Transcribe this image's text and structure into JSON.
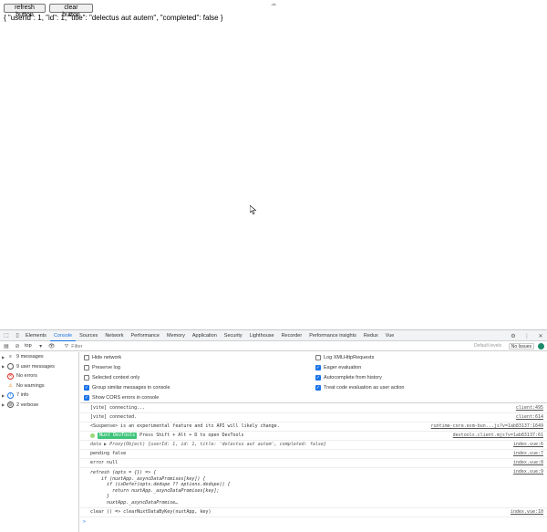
{
  "page": {
    "buttons": [
      {
        "label": "refresh button"
      },
      {
        "label": "clear button"
      }
    ],
    "json_output": "{ \"userId\": 1, \"id\": 1, \"title\": \"delectus aut autem\", \"completed\": false }"
  },
  "devtools": {
    "tabs": [
      "Elements",
      "Console",
      "Sources",
      "Network",
      "Performance",
      "Memory",
      "Application",
      "Security",
      "Lighthouse",
      "Recorder",
      "Performance insights",
      "Redux",
      "Vue"
    ],
    "active_tab": "Console",
    "toolbar": {
      "context": "top",
      "filter_placeholder": "Filter",
      "levels": "Default levels",
      "issues": "No Issues"
    },
    "sidebar": [
      {
        "label": "9 messages",
        "icon": "list-icon"
      },
      {
        "label": "9 user messages",
        "icon": "user-icon"
      },
      {
        "label": "No errors",
        "icon": "error-icon"
      },
      {
        "label": "No warnings",
        "icon": "warning-icon"
      },
      {
        "label": "7 info",
        "icon": "info-icon"
      },
      {
        "label": "2 verbose",
        "icon": "verbose-icon"
      }
    ],
    "settings_left": [
      {
        "label": "Hide network",
        "checked": false
      },
      {
        "label": "Preserve log",
        "checked": false
      },
      {
        "label": "Selected context only",
        "checked": false
      },
      {
        "label": "Group similar messages in console",
        "checked": true
      },
      {
        "label": "Show CORS errors in console",
        "checked": true
      }
    ],
    "settings_right": [
      {
        "label": "Log XMLHttpRequests",
        "checked": false
      },
      {
        "label": "Eager evaluation",
        "checked": true
      },
      {
        "label": "Autocomplete from history",
        "checked": true
      },
      {
        "label": "Treat code evaluation as user action",
        "checked": true
      }
    ],
    "messages": {
      "m1": {
        "text": "[vite] connecting...",
        "src": "client:495"
      },
      "m2": {
        "text": "[vite] connected.",
        "src": "client:614"
      },
      "m3": {
        "text": "<Suspense> is an experimental feature and its API will likely change.",
        "src": "runtime-core.esm-bun...js?v=1ab83137:1649"
      },
      "m4": {
        "badge": "Nuxt DevTools",
        "text": "Press Shift + Alt + D to open DevTools",
        "src": "devtools.client.mjs?v=1ab83137:61"
      },
      "m5": {
        "text": "data ▶ Proxy(Object) {userId: 1, id: 1, title: 'delectus aut autem', completed: false}",
        "src": "index.vue:6"
      },
      "m6": {
        "text": "pending false",
        "src": "index.vue:7"
      },
      "m7": {
        "text": "error null",
        "src": "index.vue:8"
      },
      "m8": {
        "lines": [
          "refresh (opts = {}) => {",
          "    if (nuxtApp._asyncDataPromises[key]) {",
          "      if (isDefer(opts.dedupe ?? options.dedupe)) {",
          "        return nuxtApp._asyncDataPromises[key];",
          "      }",
          "      nuxtApp._asyncDataPromise…"
        ],
        "src": "index.vue:9"
      },
      "m9": {
        "text": "clear () => clearNuxtDataByKey(nuxtApp, key)",
        "src": "index.vue:10"
      }
    },
    "prompt": ">"
  }
}
